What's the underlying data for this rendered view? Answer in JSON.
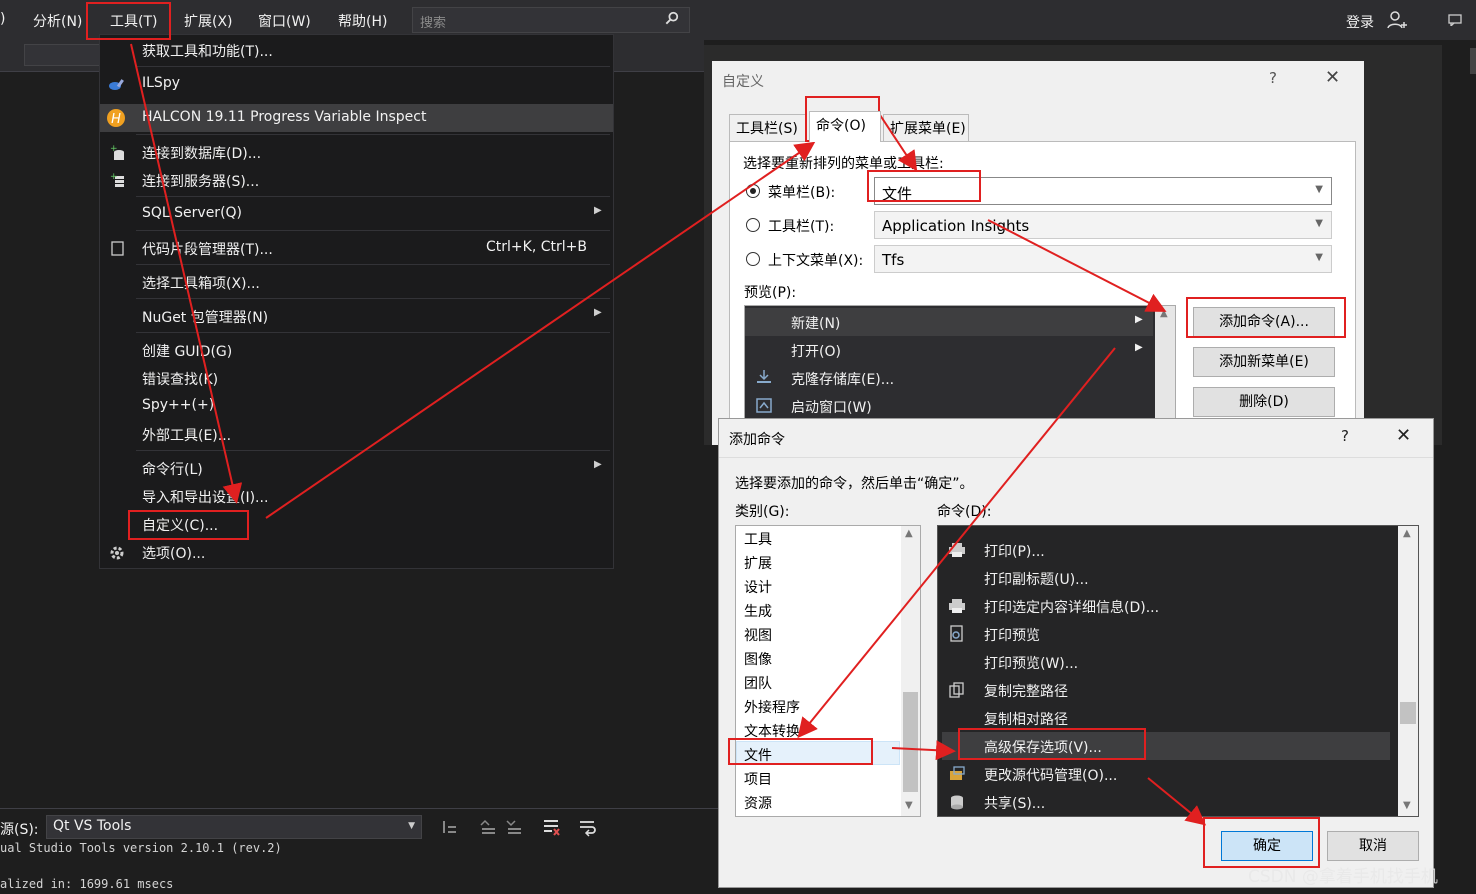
{
  "menubar": {
    "items": [
      ")",
      "分析(N)",
      "工具(T)",
      "扩展(X)",
      "窗口(W)",
      "帮助(H)"
    ],
    "search_placeholder": "搜索",
    "login": "登录"
  },
  "tools_menu": {
    "items": [
      {
        "label": "获取工具和功能(T)...",
        "icon": "none"
      },
      {
        "label": "ILSpy",
        "icon": "ilspy-icon"
      },
      {
        "label": "HALCON 19.11 Progress Variable Inspect",
        "icon": "halcon-icon"
      },
      {
        "label": "连接到数据库(D)...",
        "icon": "connect-database-icon"
      },
      {
        "label": "连接到服务器(S)...",
        "icon": "connect-server-icon"
      },
      {
        "label": "SQL Server(Q)",
        "icon": "none",
        "submenu": true
      },
      {
        "label": "代码片段管理器(T)...",
        "icon": "snippet-icon",
        "shortcut": "Ctrl+K, Ctrl+B"
      },
      {
        "label": "选择工具箱项(X)...",
        "icon": "none"
      },
      {
        "label": "NuGet 包管理器(N)",
        "icon": "none",
        "submenu": true
      },
      {
        "label": "创建 GUID(G)",
        "icon": "none"
      },
      {
        "label": "错误查找(K)",
        "icon": "none"
      },
      {
        "label": "Spy++(+)",
        "icon": "none"
      },
      {
        "label": "外部工具(E)...",
        "icon": "none"
      },
      {
        "label": "命令行(L)",
        "icon": "none",
        "submenu": true
      },
      {
        "label": "导入和导出设置(I)...",
        "icon": "none"
      },
      {
        "label": "自定义(C)...",
        "icon": "none"
      },
      {
        "label": "选项(O)...",
        "icon": "gear-icon"
      }
    ]
  },
  "customize_dialog": {
    "title": "自定义",
    "help": "?",
    "close": "✕",
    "tabs": [
      "工具栏(S)",
      "命令(O)",
      "扩展菜单(E)"
    ],
    "selected_tab": "命令(O)",
    "prompt": "选择要重新排列的菜单或工具栏:",
    "radio_menubar": "菜单栏(B):",
    "radio_toolbar": "工具栏(T):",
    "radio_context": "上下文菜单(X):",
    "menubar_value": "文件",
    "toolbar_value": "Application Insights",
    "context_value": "Tfs",
    "preview_label": "预览(P):",
    "preview_items": [
      {
        "label": "新建(N)",
        "submenu": true,
        "icon": "none"
      },
      {
        "label": "打开(O)",
        "submenu": true,
        "icon": "none"
      },
      {
        "label": "克隆存储库(E)...",
        "icon": "clone-icon"
      },
      {
        "label": "启动窗口(W)",
        "icon": "start-window-icon"
      }
    ],
    "btn_add_command": "添加命令(A)...",
    "btn_add_menu": "添加新菜单(E)",
    "btn_delete": "删除(D)"
  },
  "add_command_dialog": {
    "title": "添加命令",
    "help": "?",
    "close": "✕",
    "prompt": "选择要添加的命令，然后单击“确定”。",
    "categories_label": "类别(G):",
    "commands_label": "命令(D):",
    "categories": [
      "工具",
      "扩展",
      "设计",
      "生成",
      "视图",
      "图像",
      "团队",
      "外接程序",
      "文本转换",
      "文件",
      "项目",
      "资源"
    ],
    "selected_category": "文件",
    "commands": [
      {
        "label": "打印(P)...",
        "icon": "print-icon"
      },
      {
        "label": "打印副标题(U)...",
        "icon": "none"
      },
      {
        "label": "打印选定内容详细信息(D)...",
        "icon": "print-icon"
      },
      {
        "label": "打印预览",
        "icon": "print-preview-icon"
      },
      {
        "label": "打印预览(W)...",
        "icon": "none"
      },
      {
        "label": "复制完整路径",
        "icon": "copy-icon"
      },
      {
        "label": "复制相对路径",
        "icon": "none"
      },
      {
        "label": "高级保存选项(V)...",
        "icon": "none"
      },
      {
        "label": "更改源代码管理(O)...",
        "icon": "source-control-icon"
      },
      {
        "label": "共享(S)...",
        "icon": "share-icon"
      }
    ],
    "selected_command": "高级保存选项(V)...",
    "ok": "确定",
    "cancel": "取消"
  },
  "output_pane": {
    "source_label": "源(S):",
    "source_value": "Qt VS Tools",
    "line1": "ual Studio Tools version 2.10.1 (rev.2)",
    "line2": "alized in: 1699.61 msecs"
  },
  "watermark": "CSDN @拿着手机找手机",
  "colors": {
    "annotation": "#e02020",
    "menu_bg": "#1b1b1c",
    "dialog_bg": "#f0f0f0"
  }
}
